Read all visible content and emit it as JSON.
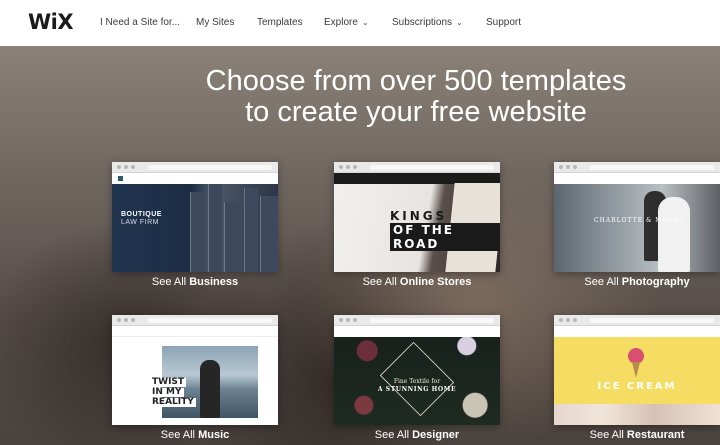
{
  "header": {
    "logo": "WiX",
    "nav": [
      {
        "label": "I Need a Site for...",
        "dropdown": false
      },
      {
        "label": "My Sites",
        "dropdown": false
      },
      {
        "label": "Templates",
        "dropdown": false
      },
      {
        "label": "Explore",
        "dropdown": true
      },
      {
        "label": "Subscriptions",
        "dropdown": true
      },
      {
        "label": "Support",
        "dropdown": false
      }
    ]
  },
  "hero": {
    "line1": "Choose from over 500 templates",
    "line2": "to create your free website"
  },
  "templates": [
    {
      "prefix": "See All ",
      "category": "Business",
      "preview": {
        "line1": "BOUTIQUE",
        "line2": "LAW FIRM"
      }
    },
    {
      "prefix": "See All ",
      "category": "Online Stores",
      "preview": {
        "line1": "KINGS",
        "line2": "OF THE ROAD"
      }
    },
    {
      "prefix": "See All ",
      "category": "Photography",
      "preview": {
        "line1": "CHARLOTTE & MOODY"
      }
    },
    {
      "prefix": "See All ",
      "category": "Music",
      "preview": {
        "line1": "TWIST",
        "line2": "IN MY",
        "line3": "REALITY"
      }
    },
    {
      "prefix": "See All ",
      "category": "Designer",
      "preview": {
        "line1": "Fine Textile for",
        "line2": "A STUNNING HOME"
      }
    },
    {
      "prefix": "See All ",
      "category": "Restaurant",
      "preview": {
        "line1": "ICE CREAM"
      }
    }
  ],
  "colors": {
    "nav_bg": "#ffffff",
    "nav_text": "#3b3b3b",
    "hero_text": "#ffffff",
    "restaurant_yellow": "#f5dd63"
  }
}
